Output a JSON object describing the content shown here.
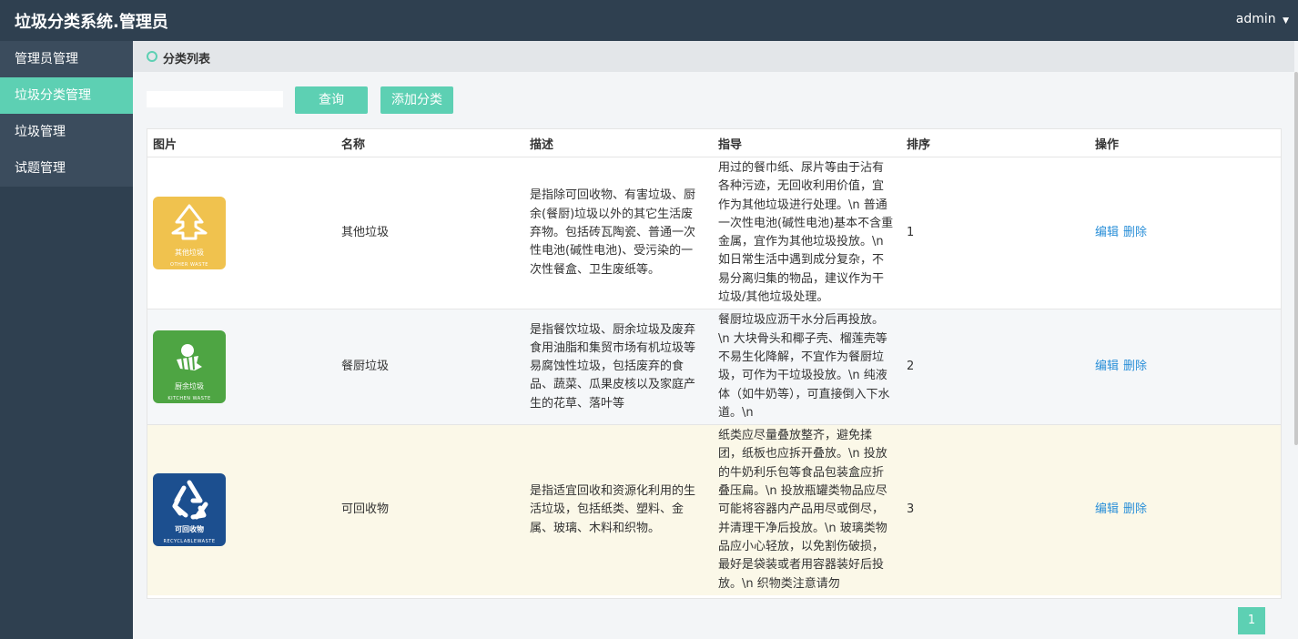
{
  "app": {
    "title": "垃圾分类系统.管理员",
    "user": "admin"
  },
  "icons": {
    "user_menu": "caret-down-icon",
    "panel": "circle-ring-icon"
  },
  "colors": {
    "topbar": "#2f4050",
    "accent": "#5dd0b3",
    "link": "#2a8fd8"
  },
  "sidebar": {
    "items": [
      {
        "label": "管理员管理"
      },
      {
        "label": "垃圾分类管理",
        "active": true
      },
      {
        "label": "垃圾管理"
      },
      {
        "label": "试题管理"
      }
    ]
  },
  "panel": {
    "title": "分类列表"
  },
  "toolbar": {
    "search_value": "",
    "query_label": "查询",
    "add_label": "添加分类"
  },
  "table": {
    "headers": [
      "图片",
      "名称",
      "描述",
      "指导",
      "排序",
      "操作"
    ],
    "edit_label": "编辑",
    "delete_label": "删除",
    "rows": [
      {
        "image": {
          "title": "其他垃圾",
          "subtitle": "OTHER WASTE",
          "color": "#f0c24e"
        },
        "name": "其他垃圾",
        "desc": "是指除可回收物、有害垃圾、厨余(餐厨)垃圾以外的其它生活废弃物。包括砖瓦陶瓷、普通一次性电池(碱性电池)、受污染的一次性餐盒、卫生废纸等。",
        "guide": "用过的餐巾纸、尿片等由于沾有各种污迹，无回收利用价值，宜作为其他垃圾进行处理。\\n 普通一次性电池(碱性电池)基本不含重金属，宜作为其他垃圾投放。\\n 如日常生活中遇到成分复杂，不易分离归集的物品，建议作为干垃圾/其他垃圾处理。",
        "sort": "1"
      },
      {
        "image": {
          "title": "厨余垃圾",
          "subtitle": "KITCHEN WASTE",
          "color": "#4ea543"
        },
        "name": "餐厨垃圾",
        "desc": "是指餐饮垃圾、厨余垃圾及废弃食用油脂和集贸市场有机垃圾等易腐蚀性垃圾，包括废弃的食品、蔬菜、瓜果皮核以及家庭产生的花草、落叶等",
        "guide": "餐厨垃圾应沥干水分后再投放。\\n 大块骨头和椰子壳、榴莲壳等不易生化降解，不宜作为餐厨垃圾，可作为干垃圾投放。\\n 纯液体（如牛奶等），可直接倒入下水道。\\n",
        "sort": "2"
      },
      {
        "image": {
          "title": "可回收物",
          "subtitle": "RECYCLABLEWASTE",
          "color": "#1c4f8f"
        },
        "name": "可回收物",
        "desc": "是指适宜回收和资源化利用的生活垃圾，包括纸类、塑料、金属、玻璃、木料和织物。",
        "guide": "纸类应尽量叠放整齐，避免揉团，纸板也应拆开叠放。\\n 投放的牛奶利乐包等食品包装盒应折叠压扁。\\n 投放瓶罐类物品应尽可能将容器内产品用尽或倒尽，并清理干净后投放。\\n 玻璃类物品应小心轻放，以免割伤破损，最好是袋装或者用容器装好后投放。\\n 织物类注意请勿",
        "sort": "3"
      }
    ]
  },
  "pagination": {
    "current": "1"
  }
}
